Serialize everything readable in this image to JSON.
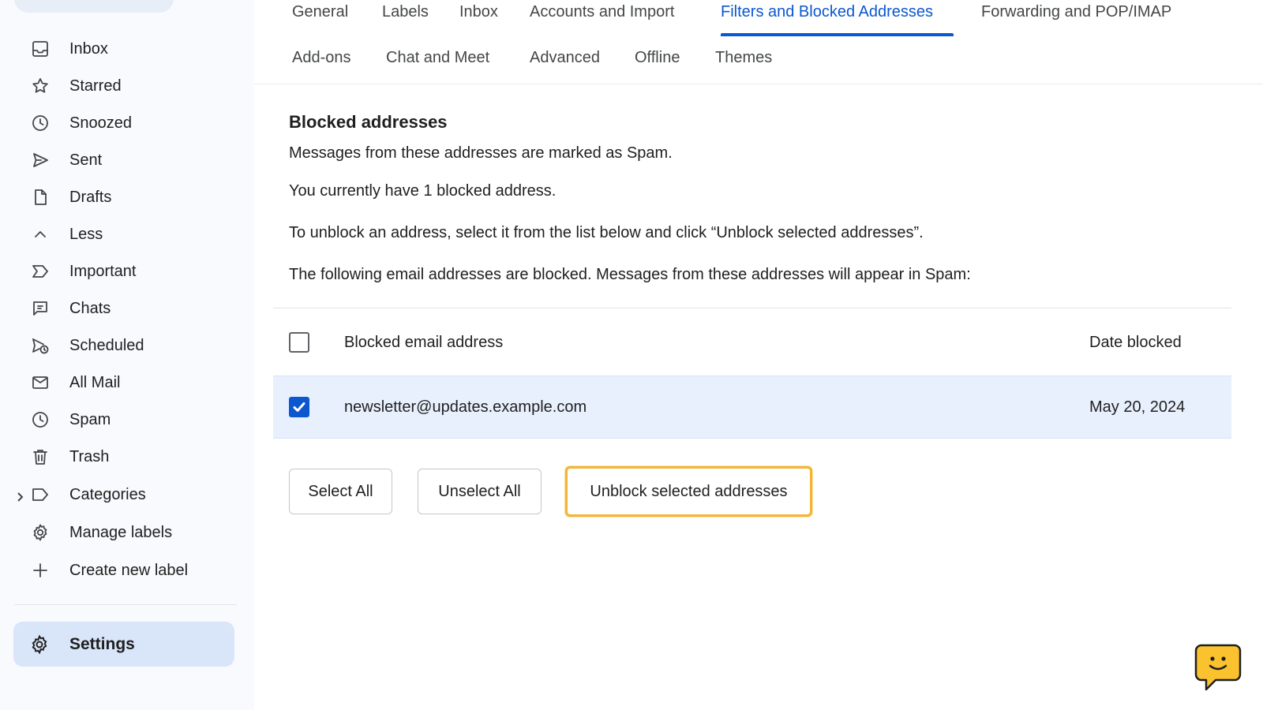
{
  "sidebar": {
    "items": [
      {
        "label": "Inbox",
        "icon": "inbox-icon"
      },
      {
        "label": "Starred",
        "icon": "star-icon"
      },
      {
        "label": "Snoozed",
        "icon": "clock-icon"
      },
      {
        "label": "Sent",
        "icon": "send-icon"
      },
      {
        "label": "Drafts",
        "icon": "draft-icon"
      },
      {
        "label": "Less",
        "icon": "chevron-up-icon"
      },
      {
        "label": "Important",
        "icon": "important-icon"
      },
      {
        "label": "Chats",
        "icon": "chat-icon"
      },
      {
        "label": "Scheduled",
        "icon": "scheduled-send-icon"
      },
      {
        "label": "All Mail",
        "icon": "mail-icon"
      },
      {
        "label": "Spam",
        "icon": "spam-icon"
      },
      {
        "label": "Trash",
        "icon": "trash-icon"
      },
      {
        "label": "Categories",
        "icon": "label-icon"
      },
      {
        "label": "Manage labels",
        "icon": "gear-icon"
      },
      {
        "label": "Create new label",
        "icon": "plus-icon"
      }
    ],
    "settings_label": "Settings"
  },
  "tabs": {
    "row1": [
      "General",
      "Labels",
      "Inbox",
      "Accounts and Import",
      "Filters and Blocked Addresses",
      "Forwarding and POP/IMAP"
    ],
    "row2": [
      "Add-ons",
      "Chat and Meet",
      "Advanced",
      "Offline",
      "Themes"
    ],
    "active": "Filters and Blocked Addresses"
  },
  "blocked": {
    "title": "Blocked addresses",
    "subtitle": "Messages from these addresses are marked as Spam.",
    "count_text": "You currently have 1 blocked address.",
    "instructions": "To unblock an address, select it from the list below and click “Unblock selected addresses”.",
    "list_intro": "The following email addresses are blocked. Messages from these addresses will appear in Spam:",
    "columns": {
      "address": "Blocked email address",
      "date": "Date blocked"
    },
    "rows": [
      {
        "address": "newsletter@updates.example.com",
        "date": "May 20, 2024",
        "selected": true
      }
    ],
    "select_all_label": "Select All",
    "unselect_all_label": "Unselect All",
    "unblock_label": "Unblock selected addresses"
  },
  "colors": {
    "accent": "#0b57d0",
    "focus_outline": "#f2b536",
    "selected_row": "#e8f0fe"
  }
}
